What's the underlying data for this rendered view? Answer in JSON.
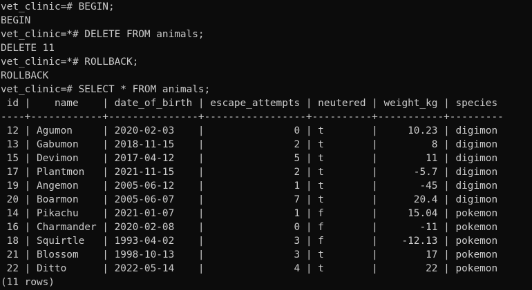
{
  "terminal": {
    "colors": {
      "background": "#0c0c0c",
      "foreground": "#cccccc"
    },
    "lines": [
      "vet_clinic=# BEGIN;",
      "BEGIN",
      "vet_clinic=*# DELETE FROM animals;",
      "DELETE 11",
      "vet_clinic=*# ROLLBACK;",
      "ROLLBACK",
      "vet_clinic=# SELECT * FROM animals;",
      " id |    name    | date_of_birth | escape_attempts | neutered | weight_kg | species",
      "----+------------+---------------+-----------------+----------+-----------+---------",
      " 12 | Agumon     | 2020-02-03    |               0 | t        |     10.23 | digimon",
      " 13 | Gabumon    | 2018-11-15    |               2 | t        |         8 | digimon",
      " 15 | Devimon    | 2017-04-12    |               5 | t        |        11 | digimon",
      " 17 | Plantmon   | 2021-11-15    |               2 | t        |      -5.7 | digimon",
      " 19 | Angemon    | 2005-06-12    |               1 | t        |       -45 | digimon",
      " 20 | Boarmon    | 2005-06-07    |               7 | t        |      20.4 | digimon",
      " 14 | Pikachu    | 2021-01-07    |               1 | f        |     15.04 | pokemon",
      " 16 | Charmander | 2020-02-08    |               0 | f        |       -11 | pokemon",
      " 18 | Squirtle   | 1993-04-02    |               3 | f        |    -12.13 | pokemon",
      " 21 | Blossom    | 1998-10-13    |               3 | t        |        17 | pokemon",
      " 22 | Ditto      | 2022-05-14    |               4 | t        |        22 | pokemon",
      "(11 rows)"
    ]
  }
}
